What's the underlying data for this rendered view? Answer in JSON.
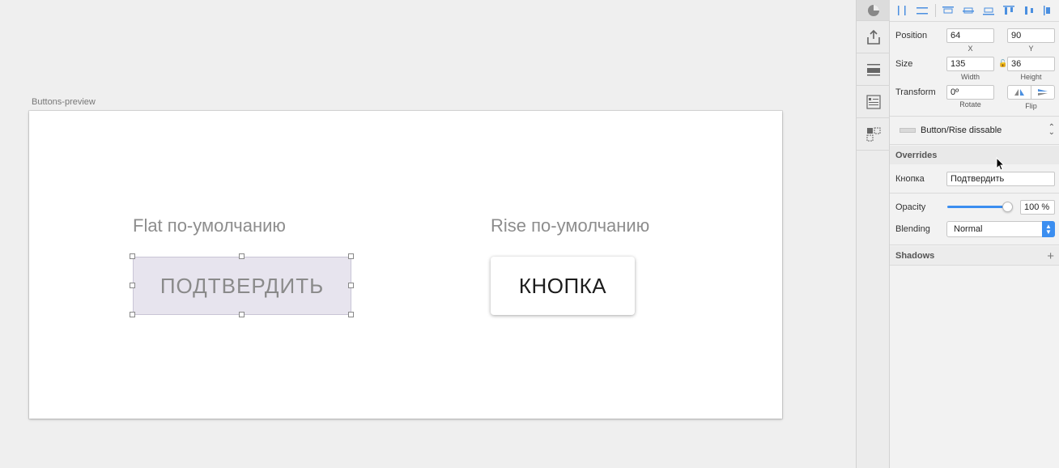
{
  "canvas": {
    "artboard_title": "Buttons-preview",
    "flat_label": "Flat по-умолчанию",
    "rise_label": "Rise по-умолчанию",
    "flat_button_text": "ПОДТВЕРДИТЬ",
    "rise_button_text": "КНОПКА"
  },
  "toolbar": {
    "icons": [
      "pie-chart-icon",
      "export-icon",
      "layer-list-icon",
      "list-icon",
      "components-icon"
    ]
  },
  "inspector": {
    "position": {
      "label": "Position",
      "x": "64",
      "y": "90",
      "x_label": "X",
      "y_label": "Y"
    },
    "size": {
      "label": "Size",
      "width": "135",
      "height": "36",
      "width_label": "Width",
      "height_label": "Height"
    },
    "transform": {
      "label": "Transform",
      "rotate": "0º",
      "rotate_label": "Rotate",
      "flip_label": "Flip"
    },
    "symbol": {
      "name": "Button/Rise dissable"
    },
    "overrides": {
      "title": "Overrides",
      "field_label": "Кнопка",
      "field_value": "Подтвердить"
    },
    "opacity": {
      "label": "Opacity",
      "value": "100 %",
      "level": 1.0
    },
    "blending": {
      "label": "Blending",
      "value": "Normal"
    },
    "shadows": {
      "title": "Shadows",
      "add": "+"
    }
  },
  "colors": {
    "accent": "#3b8ef0",
    "flat_button_bg": "#e7e4ee"
  }
}
